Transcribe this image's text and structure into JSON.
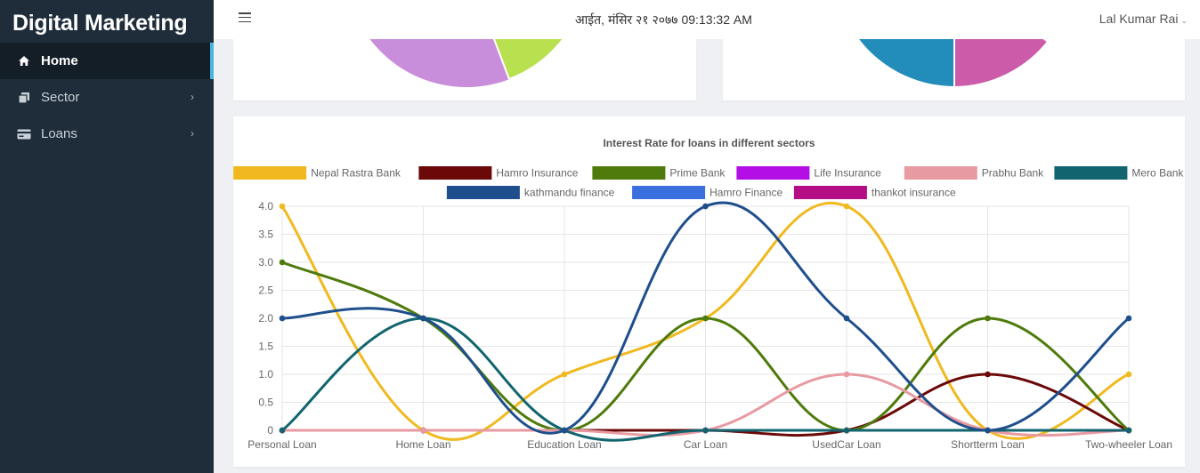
{
  "app": {
    "title": "Digital Marketing"
  },
  "sidebar": {
    "items": [
      {
        "label": "Home",
        "icon": "home-icon",
        "active": true
      },
      {
        "label": "Sector",
        "icon": "copy-icon",
        "has_children": true
      },
      {
        "label": "Loans",
        "icon": "card-icon",
        "has_children": true
      }
    ]
  },
  "topbar": {
    "datetime": "आईत, मंसिर २१ २०७७ 09:13:32 AM",
    "user": "Lal Kumar Rai"
  },
  "pie_colors": {
    "pie1": [
      "#c88ddb",
      "#b9e04f"
    ],
    "pie2": [
      "#228cba",
      "#cc5caa"
    ]
  },
  "chart_data": {
    "type": "line",
    "title": "Interest Rate for loans in different sectors",
    "categories": [
      "Personal Loan",
      "Home Loan",
      "Education Loan",
      "Car Loan",
      "UsedCar Loan",
      "Shortterm Loan",
      "Two-wheeler Loan"
    ],
    "ylim": [
      0,
      4
    ],
    "yticks": [
      "0",
      "0.5",
      "1.0",
      "1.5",
      "2.0",
      "2.5",
      "3.0",
      "3.5",
      "4.0"
    ],
    "legend_position": "top",
    "grid": true,
    "series": [
      {
        "name": "Nepal Rastra Bank",
        "color": "#f0b91f",
        "values": [
          4,
          0,
          1,
          2,
          4,
          0,
          1
        ]
      },
      {
        "name": "Hamro Insurance",
        "color": "#6b0808",
        "values": [
          0,
          0,
          0,
          0,
          0,
          1,
          0
        ]
      },
      {
        "name": "Prime Bank",
        "color": "#4e7b0b",
        "values": [
          3,
          2,
          0,
          2,
          0,
          2,
          0
        ]
      },
      {
        "name": "Life Insurance",
        "color": "#b40ee6",
        "values": [
          0,
          0,
          0,
          0,
          0,
          0,
          0
        ]
      },
      {
        "name": "Prabhu Bank",
        "color": "#e89aa2",
        "values": [
          0,
          0,
          0,
          0,
          1,
          0,
          0
        ]
      },
      {
        "name": "Mero Bank",
        "color": "#12656f",
        "values": [
          0,
          2,
          0,
          0,
          0,
          0,
          0
        ]
      },
      {
        "name": "kathmandu finance",
        "color": "#1e4f8c",
        "values": [
          2,
          2,
          0,
          4,
          2,
          0,
          2
        ]
      },
      {
        "name": "Hamro Finance",
        "color": "#3b6fde",
        "values": [
          0,
          0,
          0,
          0,
          0,
          0,
          0
        ]
      },
      {
        "name": "thankot insurance",
        "color": "#b50e84",
        "values": [
          0,
          0,
          0,
          0,
          0,
          0,
          0
        ]
      }
    ]
  }
}
